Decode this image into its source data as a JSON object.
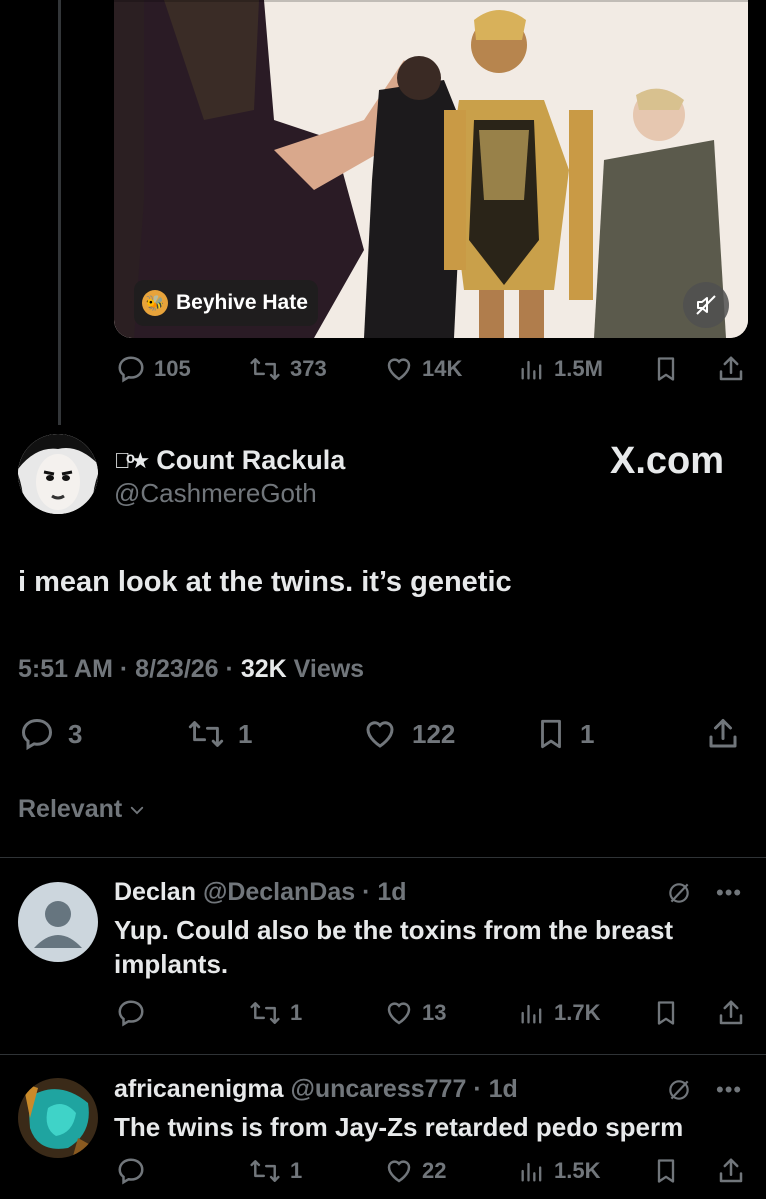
{
  "media": {
    "chip_label": "Beyhive Hate",
    "chip_avatar": "bee-avatar-icon",
    "mute_icon": "volume-muted-icon"
  },
  "quoted_actions": {
    "replies": "105",
    "reposts": "373",
    "likes": "14K",
    "views": "1.5M"
  },
  "tweet": {
    "display_name": "Count Rackula",
    "name_prefix": "◎ͦ★",
    "handle": "@CashmereGoth",
    "watermark": "X.com",
    "text": "i mean look at the twins. it’s genetic",
    "time": "5:51 AM",
    "date": "8/23/26",
    "views_count": "32K",
    "views_label": "Views",
    "replies": "3",
    "reposts": "1",
    "likes": "122",
    "bookmarks": "1"
  },
  "filter": {
    "label": "Relevant"
  },
  "replies": [
    {
      "name": "Declan",
      "handle": "@DeclanDas",
      "age": "1d",
      "text": "Yup. Could also be the toxins from the breast implants.",
      "replies": "",
      "reposts": "1",
      "likes": "13",
      "views": "1.7K"
    },
    {
      "name": "africanenigma",
      "handle": "@uncaress777",
      "age": "1d",
      "text": "The twins is from Jay-Zs retarded pedo sperm",
      "replies": "",
      "reposts": "1",
      "likes": "22",
      "views": "1.5K"
    }
  ],
  "colors": {
    "background": "#000000",
    "text": "#e7e9ea",
    "muted": "#71767b",
    "divider": "#2f3336"
  }
}
